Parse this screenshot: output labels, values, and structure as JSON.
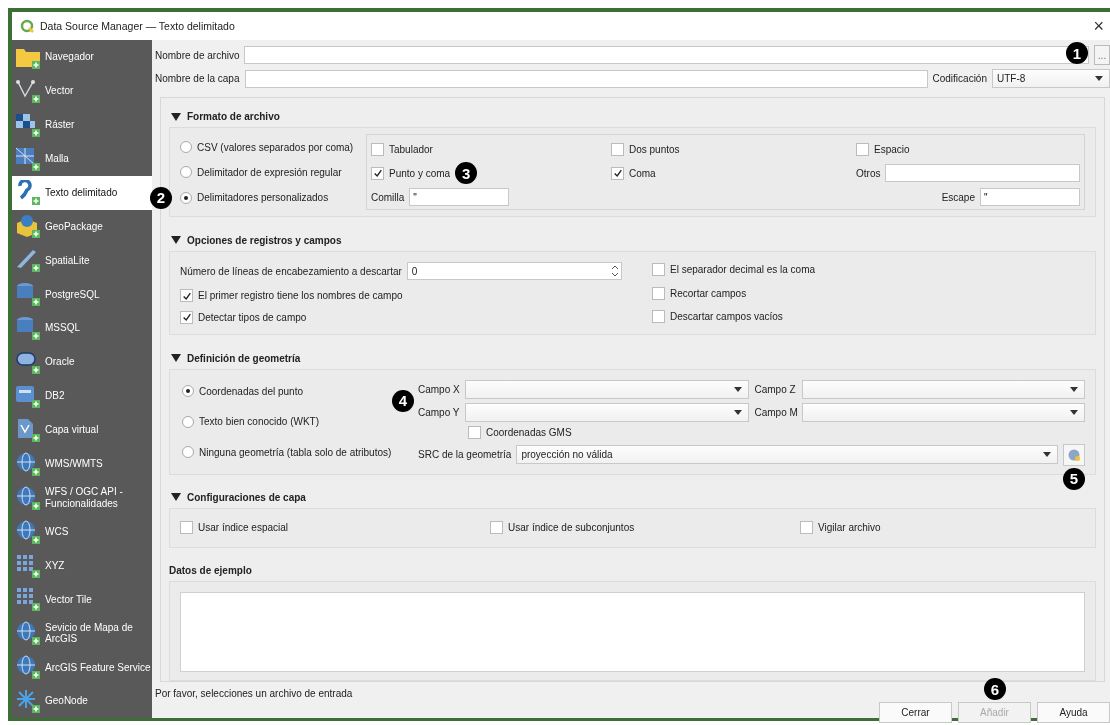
{
  "window": {
    "title": "Data Source Manager — Texto delimitado",
    "close_glyph": "×"
  },
  "sidebar": {
    "items": [
      {
        "label": "Navegador",
        "selected": false
      },
      {
        "label": "Vector",
        "selected": false
      },
      {
        "label": "Ráster",
        "selected": false
      },
      {
        "label": "Malla",
        "selected": false
      },
      {
        "label": "Texto delimitado",
        "selected": true
      },
      {
        "label": "GeoPackage",
        "selected": false
      },
      {
        "label": "SpatiaLite",
        "selected": false
      },
      {
        "label": "PostgreSQL",
        "selected": false
      },
      {
        "label": "MSSQL",
        "selected": false
      },
      {
        "label": "Oracle",
        "selected": false
      },
      {
        "label": "DB2",
        "selected": false
      },
      {
        "label": "Capa virtual",
        "selected": false
      },
      {
        "label": "WMS/WMTS",
        "selected": false
      },
      {
        "label": "WFS / OGC API - Funcionalidades",
        "selected": false
      },
      {
        "label": "WCS",
        "selected": false
      },
      {
        "label": "XYZ",
        "selected": false
      },
      {
        "label": "Vector Tile",
        "selected": false
      },
      {
        "label": "Sevicio de Mapa de ArcGIS",
        "selected": false
      },
      {
        "label": "ArcGIS Feature Service",
        "selected": false
      },
      {
        "label": "GeoNode",
        "selected": false
      }
    ]
  },
  "file": {
    "label": "Nombre de archivo",
    "browse_button": "...",
    "callout": "1"
  },
  "layer": {
    "label": "Nombre de la capa"
  },
  "encoding": {
    "label": "Codificación",
    "value": "UTF-8"
  },
  "file_format": {
    "title": "Formato de archivo",
    "options": [
      {
        "label": "CSV (valores separados por coma)",
        "selected": false
      },
      {
        "label": "Delimitador de expresión regular",
        "selected": false
      },
      {
        "label": "Delimitadores personalizados",
        "selected": true,
        "callout": "2"
      }
    ],
    "delimiters": [
      {
        "label": "Tabulador",
        "checked": false
      },
      {
        "label": "Dos puntos",
        "checked": false
      },
      {
        "label": "Espacio",
        "checked": false
      },
      {
        "label": "Punto y coma",
        "checked": true,
        "callout": "3"
      },
      {
        "label": "Coma",
        "checked": true
      }
    ],
    "others": {
      "label": "Otros"
    },
    "quote": {
      "label": "Comilla",
      "value": "\""
    },
    "escape": {
      "label": "Escape",
      "value": "\""
    }
  },
  "records": {
    "title": "Opciones de registros y campos",
    "header_lines": {
      "label": "Número de líneas de encabezamiento a descartar",
      "value": "0"
    },
    "left_checks": [
      {
        "label": "El primer registro tiene los nombres de campo",
        "checked": true
      },
      {
        "label": "Detectar tipos de campo",
        "checked": true
      }
    ],
    "right_checks": [
      {
        "label": "El separador decimal es la coma",
        "checked": false
      },
      {
        "label": "Recortar campos",
        "checked": false
      },
      {
        "label": "Descartar campos vacíos",
        "checked": false
      }
    ]
  },
  "geometry": {
    "title": "Definición de geometría",
    "callout": "4",
    "options": [
      {
        "label": "Coordenadas del punto",
        "selected": true
      },
      {
        "label": "Texto bien conocido (WKT)",
        "selected": false
      },
      {
        "label": "Ninguna geometría (tabla solo de atributos)",
        "selected": false
      }
    ],
    "fields": [
      {
        "label": "Campo X"
      },
      {
        "label": "Campo Z"
      },
      {
        "label": "Campo Y"
      },
      {
        "label": "Campo M"
      }
    ],
    "dms": {
      "label": "Coordenadas GMS",
      "checked": false
    },
    "crs": {
      "label": "SRC de la geometría",
      "value": "proyección no válida",
      "callout": "5"
    }
  },
  "layer_settings": {
    "title": "Configuraciones de capa",
    "checks": [
      {
        "label": "Usar índice espacial",
        "checked": false
      },
      {
        "label": "Usar índice de subconjuntos",
        "checked": false
      },
      {
        "label": "Vigilar archivo",
        "checked": false
      }
    ]
  },
  "sample_data": {
    "title": "Datos de ejemplo"
  },
  "status": "Por favor, selecciones un archivo de entrada",
  "buttons": [
    {
      "label": "Cerrar",
      "disabled": false
    },
    {
      "label": "Añadir",
      "disabled": true,
      "callout": "6"
    },
    {
      "label": "Ayuda",
      "disabled": false
    }
  ]
}
